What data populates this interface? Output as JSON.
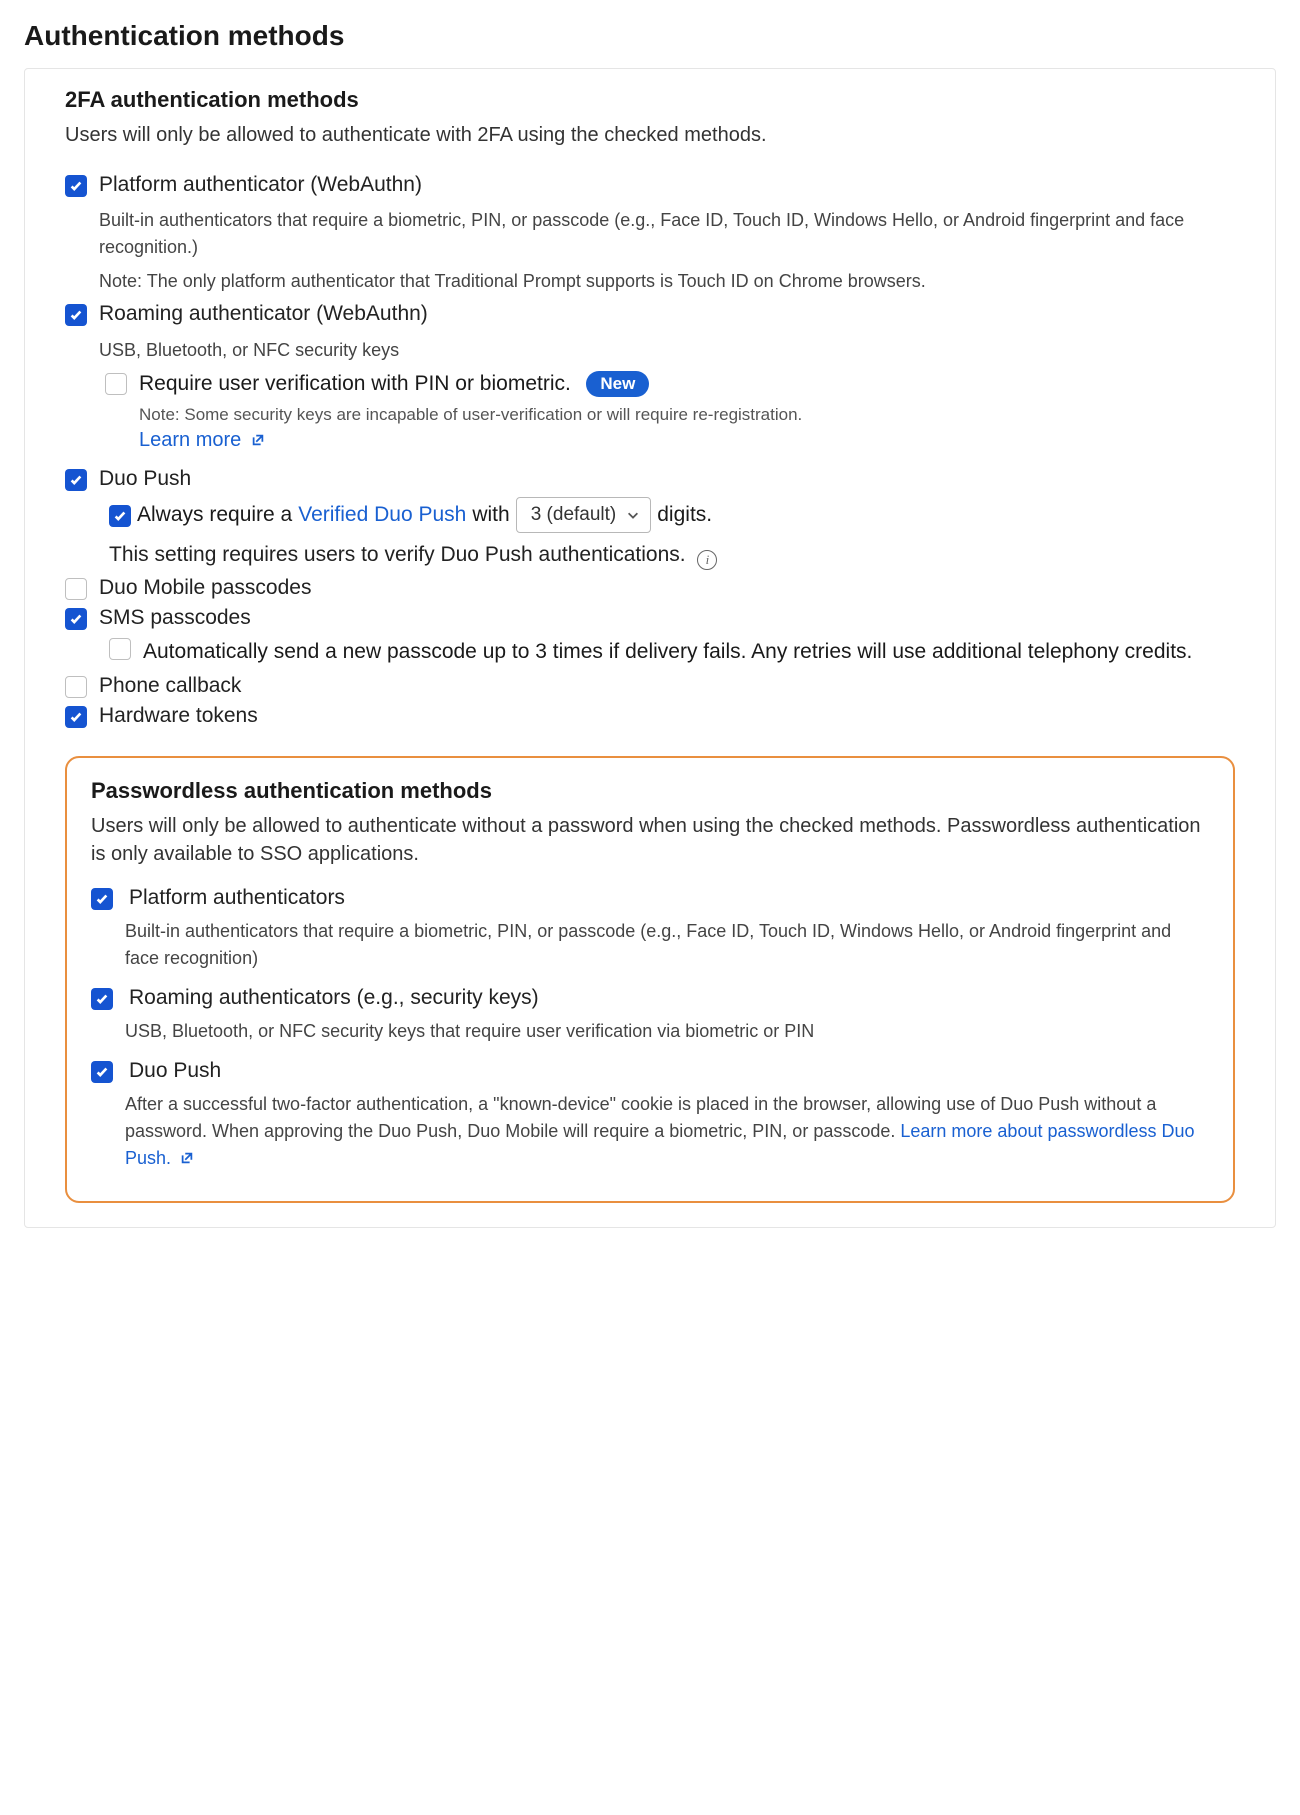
{
  "page_title": "Authentication methods",
  "twofa": {
    "title": "2FA authentication methods",
    "desc": "Users will only be allowed to authenticate with 2FA using the checked methods.",
    "platform": {
      "label": "Platform authenticator (WebAuthn)",
      "desc": "Built-in authenticators that require a biometric, PIN, or passcode (e.g., Face ID, Touch ID, Windows Hello, or Android fingerprint and face recognition.)",
      "note": "Note: The only platform authenticator that Traditional Prompt supports is Touch ID on Chrome browsers."
    },
    "roaming": {
      "label": "Roaming authenticator (WebAuthn)",
      "desc": "USB, Bluetooth, or NFC security keys",
      "require_verif_label": "Require user verification with PIN or biometric.",
      "new_badge": "New",
      "verif_note": "Note: Some security keys are incapable of user-verification or will require re-registration.",
      "learn_more": "Learn more"
    },
    "duo_push": {
      "label": "Duo Push",
      "always_prefix": "Always require a ",
      "verified_link": "Verified Duo Push",
      "always_mid": " with ",
      "digits_select": "3 (default)",
      "always_suffix": " digits.",
      "requires_text": "This setting requires users to verify Duo Push authentications."
    },
    "duo_mobile": {
      "label": "Duo Mobile passcodes"
    },
    "sms": {
      "label": "SMS passcodes",
      "auto_retry": "Automatically send a new passcode up to 3 times if delivery fails. Any retries will use additional telephony credits."
    },
    "phone": {
      "label": "Phone callback"
    },
    "hardware": {
      "label": "Hardware tokens"
    }
  },
  "passwordless": {
    "title": "Passwordless authentication methods",
    "desc": "Users will only be allowed to authenticate without a password when using the checked methods. Passwordless authentication is only available to SSO applications.",
    "platform": {
      "label": "Platform authenticators",
      "desc": "Built-in authenticators that require a biometric, PIN, or passcode (e.g., Face ID, Touch ID, Windows Hello, or Android fingerprint and face recognition)"
    },
    "roaming": {
      "label": "Roaming authenticators (e.g., security keys)",
      "desc": "USB, Bluetooth, or NFC security keys that require user verification via biometric or PIN"
    },
    "duo_push": {
      "label": "Duo Push",
      "desc": "After a successful two-factor authentication, a \"known-device\" cookie is placed in the browser, allowing use of Duo Push without a password. When approving the Duo Push, Duo Mobile will require a biometric, PIN, or passcode. ",
      "learn_more": "Learn more about passwordless Duo Push."
    }
  }
}
